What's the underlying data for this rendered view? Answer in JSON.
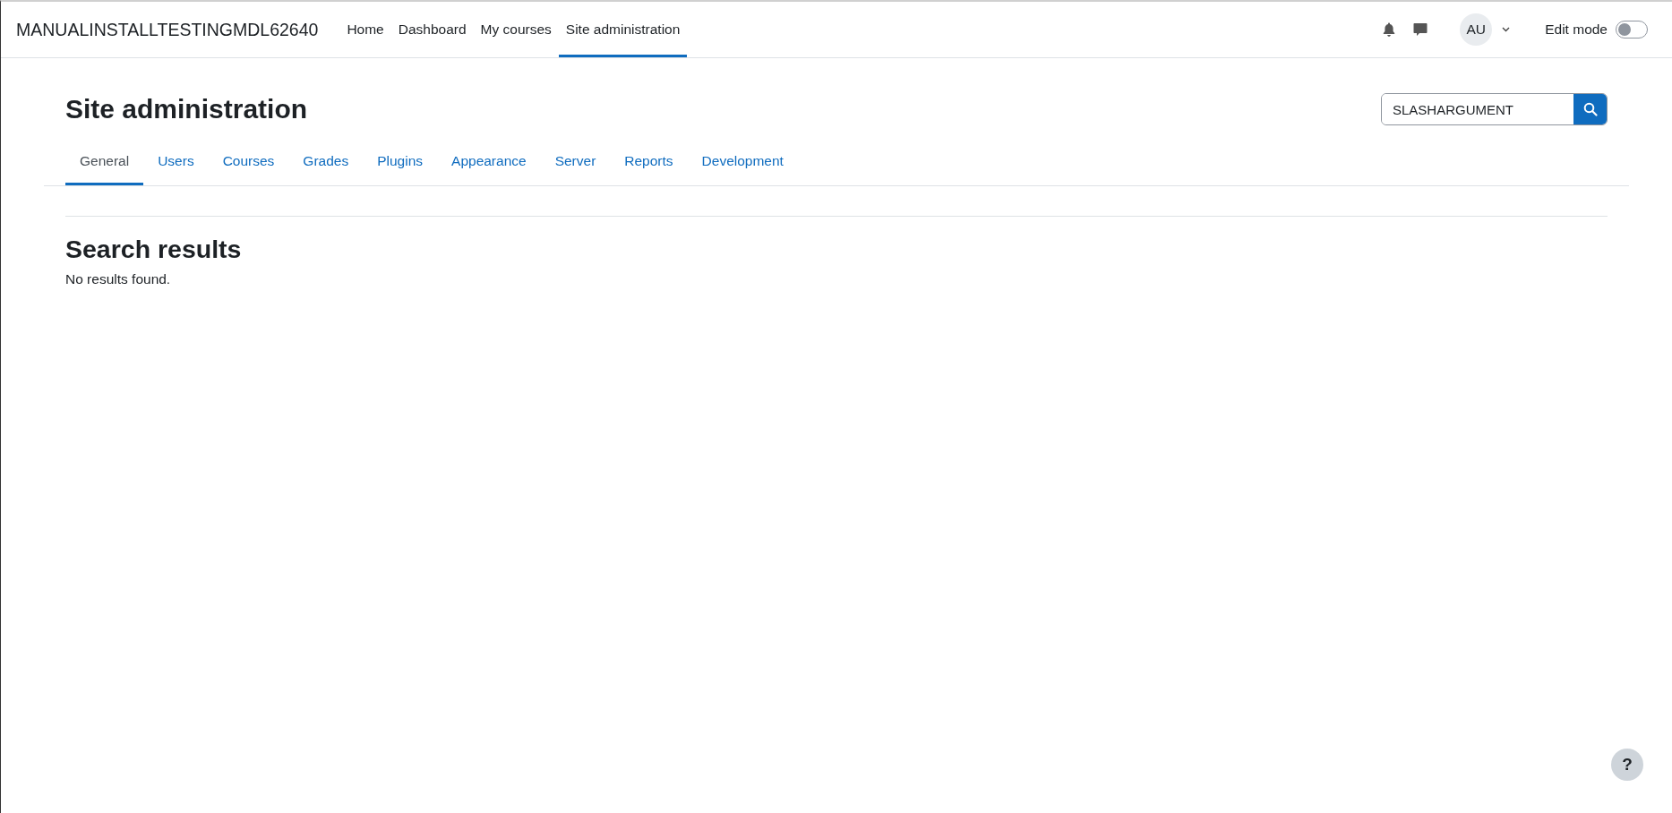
{
  "navbar": {
    "brand": "MANUALINSTALLTESTINGMDL62640",
    "items": [
      {
        "label": "Home",
        "selected": false
      },
      {
        "label": "Dashboard",
        "selected": false
      },
      {
        "label": "My courses",
        "selected": false
      },
      {
        "label": "Site administration",
        "selected": true
      }
    ],
    "avatar": "AU",
    "edit_mode": {
      "label": "Edit mode",
      "on": false
    }
  },
  "page": {
    "title": "Site administration",
    "search": {
      "value": "SLASHARGUMENT"
    },
    "tabs": [
      {
        "label": "General",
        "selected": true
      },
      {
        "label": "Users",
        "selected": false
      },
      {
        "label": "Courses",
        "selected": false
      },
      {
        "label": "Grades",
        "selected": false
      },
      {
        "label": "Plugins",
        "selected": false
      },
      {
        "label": "Appearance",
        "selected": false
      },
      {
        "label": "Server",
        "selected": false
      },
      {
        "label": "Reports",
        "selected": false
      },
      {
        "label": "Development",
        "selected": false
      }
    ],
    "results_heading": "Search results",
    "results_message": "No results found."
  },
  "help_button": "?"
}
